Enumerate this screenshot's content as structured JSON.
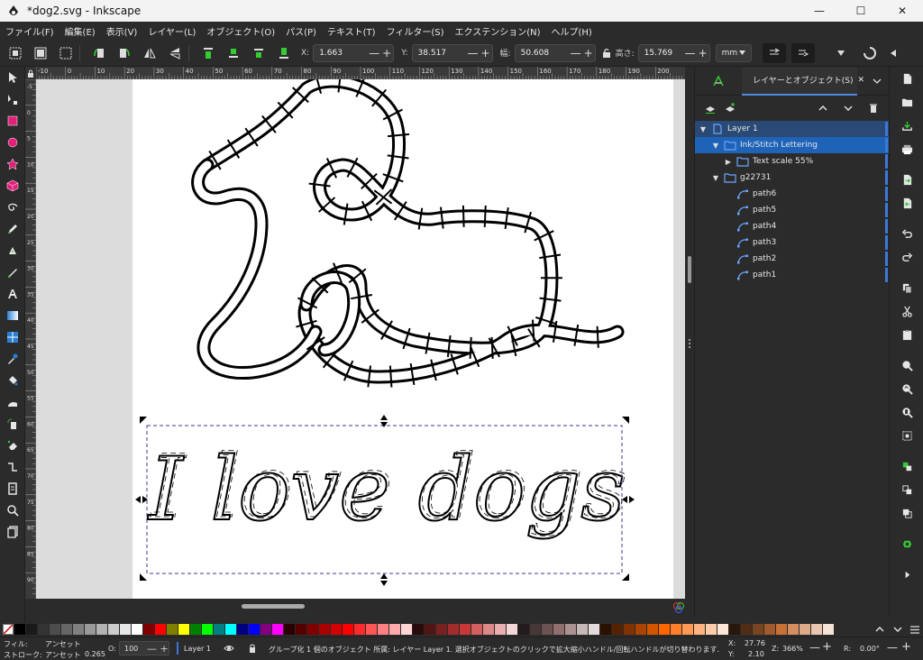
{
  "window": {
    "title": "*dog2.svg - Inkscape",
    "minimize": "—",
    "maximize": "☐",
    "close": "✕"
  },
  "menu": [
    {
      "label": "ファイル(F)"
    },
    {
      "label": "編集(E)"
    },
    {
      "label": "表示(V)"
    },
    {
      "label": "レイヤー(L)"
    },
    {
      "label": "オブジェクト(O)"
    },
    {
      "label": "パス(P)"
    },
    {
      "label": "テキスト(T)"
    },
    {
      "label": "フィルター(S)"
    },
    {
      "label": "エクステンション(N)"
    },
    {
      "label": "ヘルプ(H)"
    }
  ],
  "tool_controls": {
    "x_label": "X:",
    "x_value": "1.663",
    "y_label": "Y:",
    "y_value": "38.517",
    "w_label": "幅:",
    "w_value": "50.608",
    "h_label": "高さ:",
    "h_value": "15.769",
    "unit": "mm",
    "minus": "—",
    "plus": "+"
  },
  "rulers": {
    "h_labels": [
      "-10",
      "0",
      "10",
      "20",
      "30",
      "40",
      "50",
      "60",
      "70",
      "80",
      "90",
      "100",
      "110",
      "120",
      "130",
      "140",
      "150",
      "160",
      "170",
      "180",
      "190",
      "200"
    ],
    "v_labels": [
      "-5",
      "0",
      "5",
      "10",
      "15",
      "20",
      "25",
      "30",
      "35",
      "40",
      "45",
      "50",
      "55",
      "60",
      "65",
      "70",
      "75",
      "80",
      "85",
      "90"
    ]
  },
  "dock": {
    "tab_active": "レイヤーとオブジェクト(S)",
    "tab_close": "✕",
    "tree": [
      {
        "label": "Layer 1",
        "level": 0,
        "expanded": true,
        "kind": "layer",
        "state": "sel"
      },
      {
        "label": "Ink/Stitch Lettering",
        "level": 1,
        "expanded": true,
        "kind": "group",
        "state": "sel2"
      },
      {
        "label": "Text scale 55%",
        "level": 2,
        "expanded": false,
        "kind": "group",
        "state": ""
      },
      {
        "label": "g22731",
        "level": 1,
        "expanded": true,
        "kind": "group",
        "state": ""
      },
      {
        "label": "path6",
        "level": 2,
        "expanded": null,
        "kind": "path",
        "state": ""
      },
      {
        "label": "path5",
        "level": 2,
        "expanded": null,
        "kind": "path",
        "state": ""
      },
      {
        "label": "path4",
        "level": 2,
        "expanded": null,
        "kind": "path",
        "state": ""
      },
      {
        "label": "path3",
        "level": 2,
        "expanded": null,
        "kind": "path",
        "state": ""
      },
      {
        "label": "path2",
        "level": 2,
        "expanded": null,
        "kind": "path",
        "state": ""
      },
      {
        "label": "path1",
        "level": 2,
        "expanded": null,
        "kind": "path",
        "state": ""
      }
    ]
  },
  "palette": [
    "#000000",
    "#1a1a1a",
    "#333333",
    "#4d4d4d",
    "#666666",
    "#808080",
    "#999999",
    "#b3b3b3",
    "#cccccc",
    "#e6e6e6",
    "#ffffff",
    "#800000",
    "#ff0000",
    "#808000",
    "#ffff00",
    "#008000",
    "#00ff00",
    "#008080",
    "#00ffff",
    "#000080",
    "#0000ff",
    "#800080",
    "#ff00ff",
    "#2b0000",
    "#550000",
    "#800000",
    "#aa0000",
    "#d40000",
    "#ff0000",
    "#ff2a2a",
    "#ff5555",
    "#ff8080",
    "#ffaaaa",
    "#ffd5d5",
    "#280b0b",
    "#501616",
    "#782121",
    "#a02c2c",
    "#c83737",
    "#d35f5f",
    "#de8787",
    "#e9afaf",
    "#f4d7d7",
    "#241c1c",
    "#483737",
    "#6c5353",
    "#916f6f",
    "#ac9393",
    "#c8b7b7",
    "#e3dbdb",
    "#2b1100",
    "#552200",
    "#803300",
    "#aa4400",
    "#d45500",
    "#ff6600",
    "#ff7f2a",
    "#ff9955",
    "#ffb380",
    "#ffccaa",
    "#ffe6d5",
    "#28170b",
    "#502d16",
    "#784421",
    "#a05a2c",
    "#c87137",
    "#d38d5f",
    "#deaa87",
    "#e9c6af",
    "#f4e3d7"
  ],
  "status": {
    "fill_label": "フィル:",
    "fill_value": "アンセット",
    "stroke_label": "ストローク:",
    "stroke_value": "アンセット",
    "stroke_width": "0.265",
    "opacity_label": "O:",
    "opacity_value": "100",
    "layer": "Layer 1",
    "message": "グループ化 1 個のオブジェクト 所属: レイヤー Layer 1. 選択オブジェクトのクリックで拡大縮小ハンドル/回転ハンドルが切り替わります.",
    "x_label": "X:",
    "x_value": "27.76",
    "y_label": "Y:",
    "y_value": "2.10",
    "zoom_label": "Z:",
    "zoom_value": "366%",
    "rotation_label": "R:",
    "rotation_value": "0.00°"
  },
  "canvas": {
    "lettering_text": "I love dogs"
  }
}
